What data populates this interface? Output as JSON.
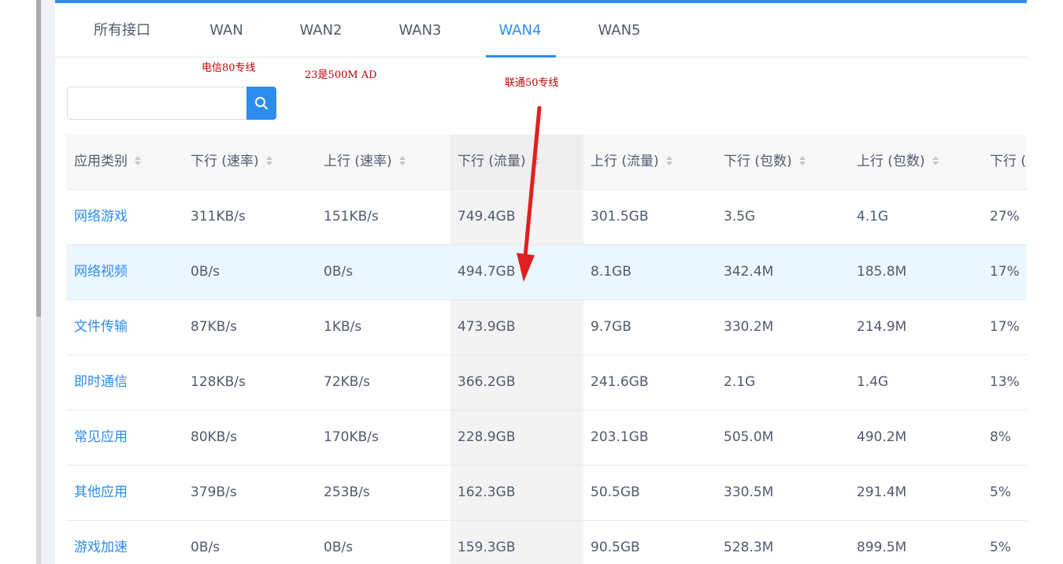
{
  "tabs": [
    {
      "label": "所有接口",
      "active": false
    },
    {
      "label": "WAN",
      "active": false
    },
    {
      "label": "WAN2",
      "active": false
    },
    {
      "label": "WAN3",
      "active": false
    },
    {
      "label": "WAN4",
      "active": true
    },
    {
      "label": "WAN5",
      "active": false
    }
  ],
  "annotations": {
    "wan_note": "电信80专线",
    "wan2_note": "23是500M AD",
    "wan4_note": "联通50专线",
    "arrow_color": "#e02020"
  },
  "search": {
    "value": "",
    "placeholder": "",
    "icon": "search-icon"
  },
  "colors": {
    "accent": "#2d8cf0",
    "hover_row": "#ebf7ff"
  },
  "table": {
    "columns": [
      "应用类别",
      "下行 (速率)",
      "上行 (速率)",
      "下行 (流量)",
      "上行 (流量)",
      "下行 (包数)",
      "上行 (包数)",
      "下行 (比"
    ],
    "rows": [
      [
        "网络游戏",
        "311KB/s",
        "151KB/s",
        "749.4GB",
        "301.5GB",
        "3.5G",
        "4.1G",
        "27%"
      ],
      [
        "网络视频",
        "0B/s",
        "0B/s",
        "494.7GB",
        "8.1GB",
        "342.4M",
        "185.8M",
        "17%"
      ],
      [
        "文件传输",
        "87KB/s",
        "1KB/s",
        "473.9GB",
        "9.7GB",
        "330.2M",
        "214.9M",
        "17%"
      ],
      [
        "即时通信",
        "128KB/s",
        "72KB/s",
        "366.2GB",
        "241.6GB",
        "2.1G",
        "1.4G",
        "13%"
      ],
      [
        "常见应用",
        "80KB/s",
        "170KB/s",
        "228.9GB",
        "203.1GB",
        "505.0M",
        "490.2M",
        "8%"
      ],
      [
        "其他应用",
        "379B/s",
        "253B/s",
        "162.3GB",
        "50.5GB",
        "330.5M",
        "291.4M",
        "5%"
      ],
      [
        "游戏加速",
        "0B/s",
        "0B/s",
        "159.3GB",
        "90.5GB",
        "528.3M",
        "899.5M",
        "5%"
      ]
    ]
  }
}
